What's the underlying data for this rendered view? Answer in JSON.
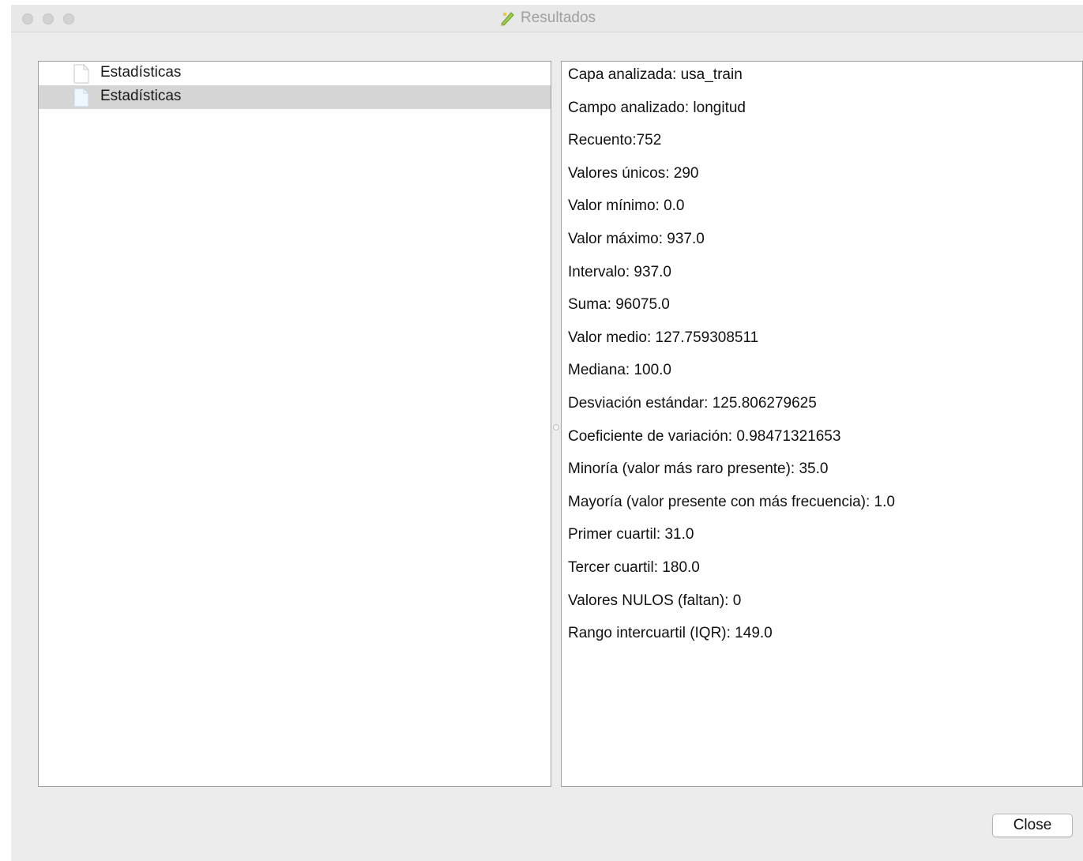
{
  "window": {
    "title": "Resultados"
  },
  "tree": {
    "items": [
      {
        "label": "Estadísticas",
        "selected": false
      },
      {
        "label": "Estadísticas",
        "selected": true
      }
    ]
  },
  "results": {
    "lines": [
      "Capa analizada: usa_train",
      "Campo analizado: longitud",
      "Recuento:752",
      "Valores únicos: 290",
      "Valor mínimo: 0.0",
      "Valor máximo: 937.0",
      "Intervalo: 937.0",
      "Suma: 96075.0",
      "Valor medio: 127.759308511",
      "Mediana: 100.0",
      "Desviación estándar: 125.806279625",
      "Coeficiente de variación: 0.98471321653",
      "Minoría (valor más raro presente): 35.0",
      "Mayoría (valor presente con más frecuencia): 1.0",
      "Primer cuartil: 31.0",
      "Tercer cuartil: 180.0",
      "Valores NULOS (faltan): 0",
      "Rango intercuartil (IQR): 149.0"
    ]
  },
  "footer": {
    "close_label": "Close"
  }
}
